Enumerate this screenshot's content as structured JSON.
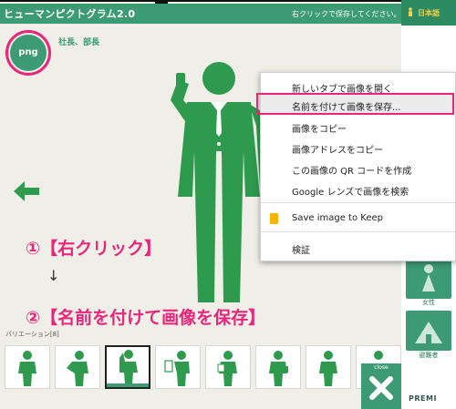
{
  "header": {
    "app_title": "ヒューマンピクトグラム2.0",
    "hint": "右クリックで保存してください。"
  },
  "right_panel": {
    "language": "日本語",
    "tiles": [
      {
        "label": ""
      },
      {
        "label": "女性"
      },
      {
        "label": "避難者"
      }
    ],
    "brand": "PREMI"
  },
  "canvas": {
    "format_button": "png",
    "subtitle": "社長、部長"
  },
  "context_menu": {
    "items": [
      "新しいタブで画像を開く",
      "名前を付けて画像を保存...",
      "画像をコピー",
      "画像アドレスをコピー",
      "この画像の QR コードを作成",
      "Google レンズで画像を検索",
      "Save image to Keep",
      "検証"
    ],
    "highlighted_index": 1
  },
  "annotation": {
    "step1": "①【右クリック】",
    "arrow": "↓",
    "step2": "②【名前を付けて画像を保存】"
  },
  "variations": {
    "label": "バリエーション[8]",
    "selected_index": 2,
    "close_label": "close"
  },
  "colors": {
    "brand_green": "#3c9b74",
    "highlight_pink": "#e9267b",
    "pictogram_green": "#2e9a4e"
  }
}
